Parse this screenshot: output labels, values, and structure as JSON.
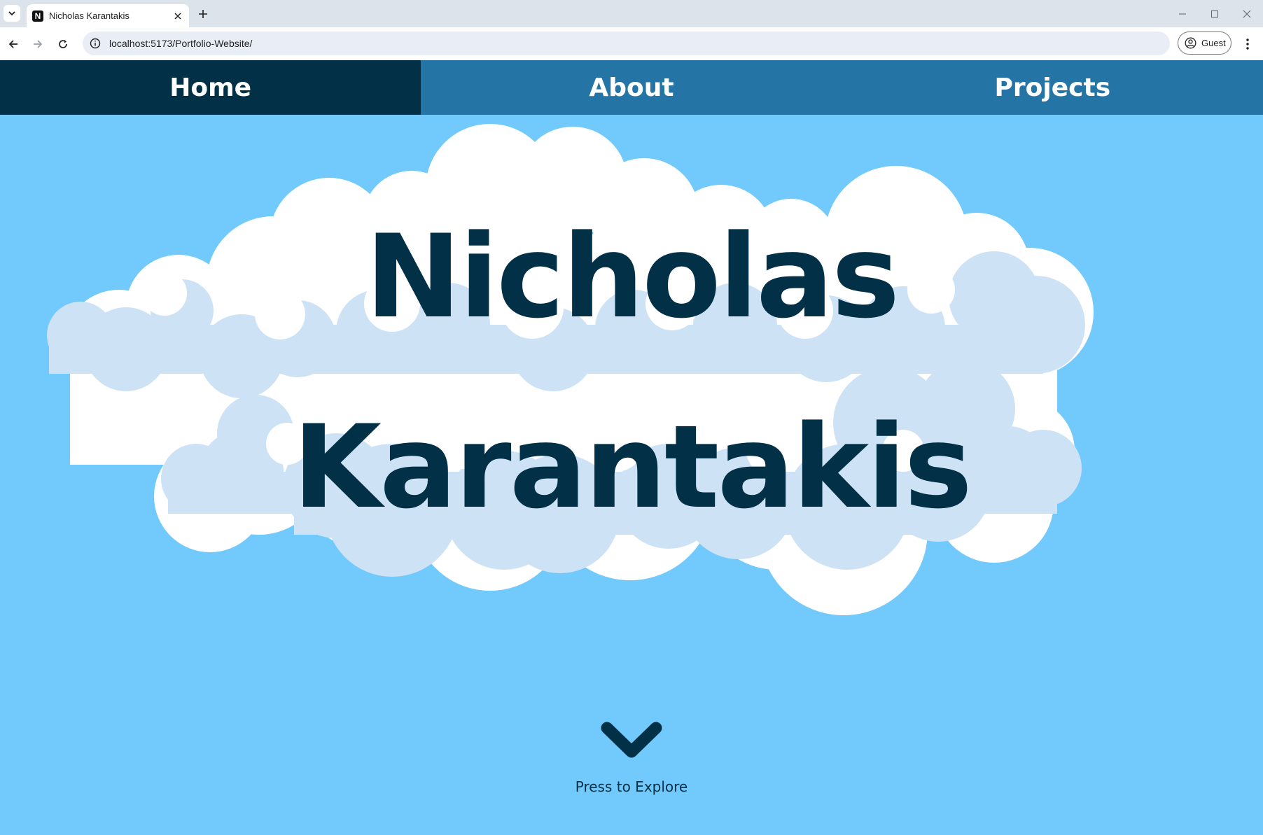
{
  "browser": {
    "tab_title": "Nicholas Karantakis",
    "favicon_letter": "N",
    "url": "localhost:5173/Portfolio-Website/",
    "profile_label": "Guest"
  },
  "nav": {
    "items": [
      {
        "label": "Home",
        "active": true
      },
      {
        "label": "About",
        "active": false
      },
      {
        "label": "Projects",
        "active": false
      }
    ]
  },
  "hero": {
    "first_name": "Nicholas",
    "last_name": "Karantakis",
    "explore_label": "Press to Explore"
  },
  "colors": {
    "sky": "#72c9fc",
    "nav_bar": "#2474a6",
    "nav_active": "#023047",
    "text_dark": "#023047",
    "cloud_white": "#ffffff",
    "cloud_shadow": "#cde2f5"
  }
}
